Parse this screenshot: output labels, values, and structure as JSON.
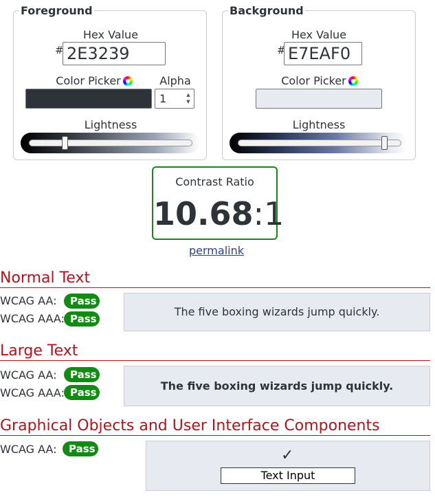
{
  "foreground": {
    "legend": "Foreground",
    "hex_label": "Hex Value",
    "hash": "#",
    "hex_value": "2E3239",
    "color_picker_label": "Color Picker",
    "alpha_label": "Alpha",
    "alpha_value": "1",
    "lightness_label": "Lightness",
    "lightness_level": 0.23,
    "swatch_color": "#2e3239"
  },
  "background": {
    "legend": "Background",
    "hex_label": "Hex Value",
    "hash": "#",
    "hex_value": "E7EAF0",
    "color_picker_label": "Color Picker",
    "lightness_label": "Lightness",
    "lightness_level": 0.92,
    "swatch_color": "#e7eaf0"
  },
  "contrast": {
    "label": "Contrast Ratio",
    "ratio": "10.68",
    "separator": ":",
    "suffix": "1",
    "border_color": "#138a13"
  },
  "permalink": "permalink",
  "sections": {
    "normal_text": {
      "title": "Normal Text",
      "aa_label": "WCAG AA:",
      "aa_result": "Pass",
      "aaa_label": "WCAG AAA:",
      "aaa_result": "Pass",
      "sample": "The five boxing wizards jump quickly."
    },
    "large_text": {
      "title": "Large Text",
      "aa_label": "WCAG AA:",
      "aa_result": "Pass",
      "aaa_label": "WCAG AAA:",
      "aaa_result": "Pass",
      "sample": "The five boxing wizards jump quickly."
    },
    "graphical": {
      "title": "Graphical Objects and User Interface Components",
      "aa_label": "WCAG AA:",
      "aa_result": "Pass",
      "check_icon": "checkmark-icon",
      "input_value": "Text Input"
    }
  },
  "colors": {
    "pass": "#138a13",
    "heading": "#b3131b",
    "link": "#2a3f9a"
  }
}
